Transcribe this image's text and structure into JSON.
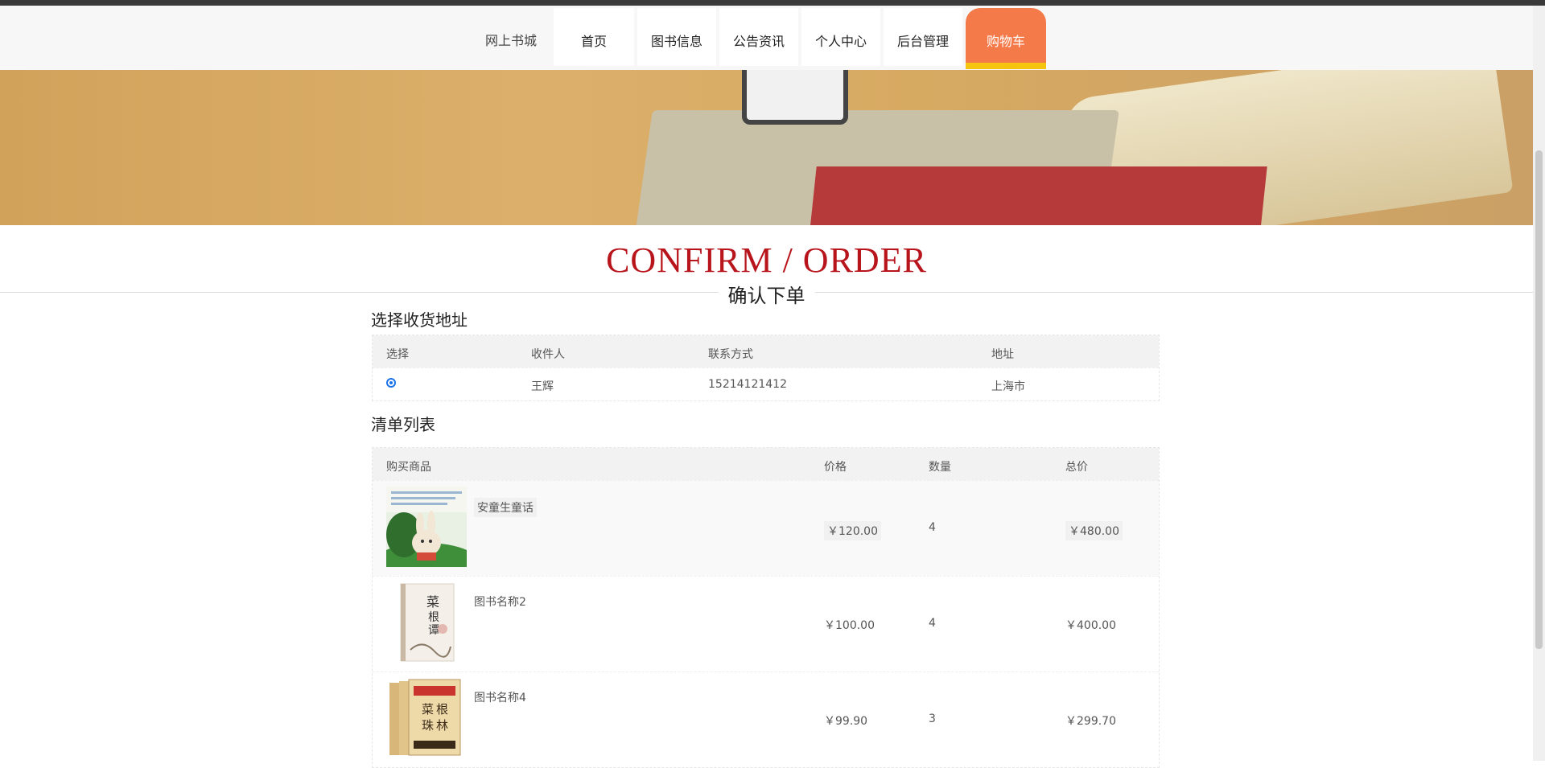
{
  "nav": {
    "brand": "网上书城",
    "items": [
      "首页",
      "图书信息",
      "公告资讯",
      "个人中心",
      "后台管理",
      "购物车"
    ],
    "active_index": 5,
    "active_color": "#f47a4a",
    "active_underline_color": "#f4c40f"
  },
  "heading": {
    "en": "CONFIRM / ORDER",
    "cn": "确认下单",
    "en_color": "#b8141b"
  },
  "address": {
    "title": "选择收货地址",
    "columns": [
      "选择",
      "收件人",
      "联系方式",
      "地址"
    ],
    "rows": [
      {
        "selected": true,
        "name": "王辉",
        "phone": "15214121412",
        "addr": "上海市"
      }
    ]
  },
  "list": {
    "title": "清单列表",
    "columns": [
      "购买商品",
      "价格",
      "数量",
      "总价"
    ],
    "rows": [
      {
        "name": "安童生童话",
        "price": "￥120.00",
        "qty": "4",
        "total": "￥480.00",
        "cover_icon": "book-cover-rabbit"
      },
      {
        "name": "图书名称2",
        "price": "￥100.00",
        "qty": "4",
        "total": "￥400.00",
        "cover_icon": "book-cover-white"
      },
      {
        "name": "图书名称4",
        "price": "￥99.90",
        "qty": "3",
        "total": "￥299.70",
        "cover_icon": "book-cover-set"
      }
    ]
  }
}
